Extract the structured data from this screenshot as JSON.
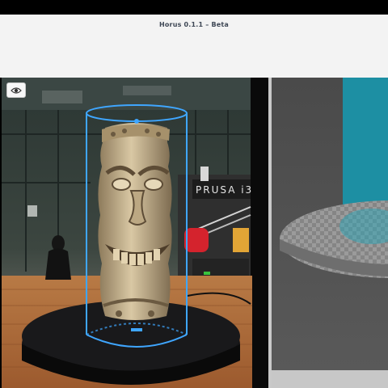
{
  "window": {
    "title": "Horus 0.1.1 – Beta"
  },
  "toolbar": {
    "eye_icon": "eye-icon"
  },
  "camera": {
    "printer_label": "PRUSA i3",
    "bounding_cylinder_color": "#3fa6ff"
  },
  "scene": {
    "platform_color": "#7a7a7a",
    "highlight_color": "#1d8fa3"
  },
  "colors": {
    "titlebar_bg": "#f3f3f3",
    "accent": "#3fa6ff"
  }
}
